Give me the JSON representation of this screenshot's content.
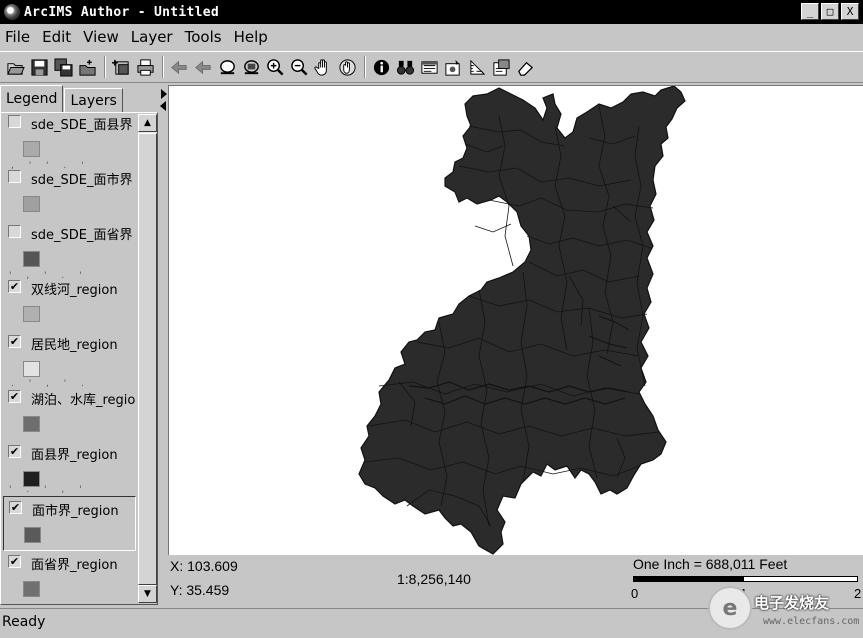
{
  "window": {
    "title": "ArcIMS Author - Untitled",
    "minimize_glyph": "_",
    "maximize_glyph": "□",
    "close_glyph": "X"
  },
  "menu": [
    "File",
    "Edit",
    "View",
    "Layer",
    "Tools",
    "Help"
  ],
  "toolbar_icons": [
    "open-folder-icon",
    "save-icon",
    "save-all-icon",
    "new-folder-icon",
    "add-layer-icon",
    "print-icon",
    "back-extent-icon",
    "forward-extent-icon",
    "zoom-full-icon",
    "zoom-active-icon",
    "zoom-in-icon",
    "zoom-out-icon",
    "pan-icon",
    "pan-globe-icon",
    "identify-icon",
    "find-icon",
    "query-icon",
    "buffer-icon",
    "measure-icon",
    "properties-icon",
    "eraser-icon"
  ],
  "tabs": {
    "legend": "Legend",
    "layers": "Layers",
    "active": "legend"
  },
  "legend": [
    {
      "label": "sde_SDE_面县界",
      "checked": false,
      "swatch": "#aaaaaa"
    },
    {
      "label": "sde_SDE_面市界",
      "checked": false,
      "swatch": "#a0a0a0"
    },
    {
      "label": "sde_SDE_面省界",
      "checked": false,
      "swatch": "#555555"
    },
    {
      "label": "双线河_region",
      "checked": true,
      "swatch": "#b0b0b0"
    },
    {
      "label": "居民地_region",
      "checked": true,
      "swatch": "#e2e2e2"
    },
    {
      "label": "湖泊、水库_regio",
      "checked": true,
      "swatch": "#6e6e6e"
    },
    {
      "label": "面县界_region",
      "checked": true,
      "swatch": "#1f1f1f"
    },
    {
      "label": "面市界_region",
      "checked": true,
      "swatch": "#5a5a5a",
      "selected": true
    },
    {
      "label": "面省界_region",
      "checked": true,
      "swatch": "#707070"
    }
  ],
  "map": {
    "fill": "#2b2b2b",
    "outline": "#111111",
    "background": "#ffffff"
  },
  "coords": {
    "x": "X: 103.609",
    "y": "Y: 35.459"
  },
  "scale": {
    "ratio": "1:8,256,140",
    "label": "One Inch = 688,011 Feet",
    "ticks": [
      "0",
      "1",
      "2"
    ]
  },
  "status": "Ready",
  "watermark": {
    "name": "电子发烧友",
    "url": "www.elecfans.com"
  }
}
